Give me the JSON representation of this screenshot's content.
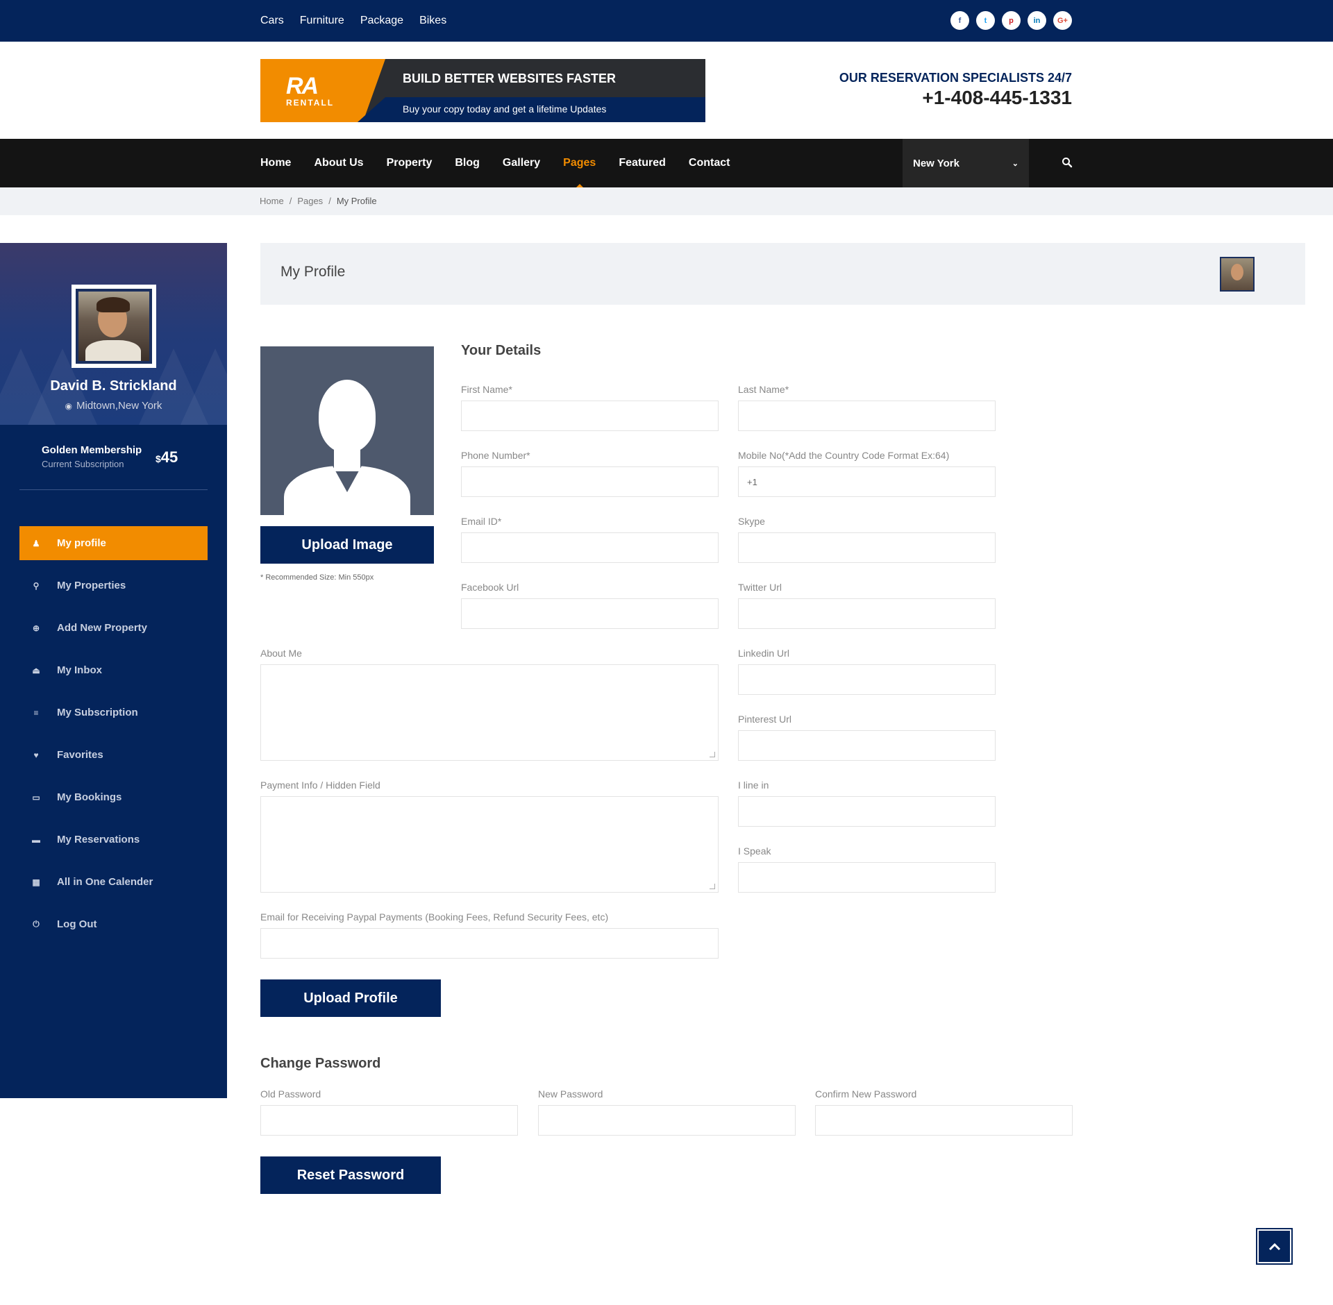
{
  "topbar": {
    "links": [
      "Cars",
      "Furniture",
      "Package",
      "Bikes"
    ],
    "socials": [
      {
        "icon": "facebook-icon",
        "glyph": "f",
        "color": "#3b5998"
      },
      {
        "icon": "twitter-icon",
        "glyph": "t",
        "color": "#1da1f2"
      },
      {
        "icon": "pinterest-icon",
        "glyph": "p",
        "color": "#cb2027"
      },
      {
        "icon": "linkedin-icon",
        "glyph": "in",
        "color": "#0077b5"
      },
      {
        "icon": "google-plus-icon",
        "glyph": "G+",
        "color": "#dd4b39"
      }
    ]
  },
  "header": {
    "banner_logo_mark": "RA",
    "banner_logo_name": "RENTALL",
    "banner_title": "BUILD BETTER WEBSITES FASTER",
    "banner_subtitle": "Buy your copy today and get a lifetime Updates",
    "reservation_label": "OUR RESERVATION SPECIALISTS 24/7",
    "reservation_phone": "+1-408-445-1331"
  },
  "nav": {
    "items": [
      "Home",
      "About Us",
      "Property",
      "Blog",
      "Gallery",
      "Pages",
      "Featured",
      "Contact"
    ],
    "active": "Pages",
    "city": "New York",
    "city_icon": "chevron-down-icon",
    "search_icon": "search-icon"
  },
  "breadcrumb": {
    "items": [
      "Home",
      "Pages",
      "My Profile"
    ],
    "separator": "/"
  },
  "sidebar": {
    "name": "David B. Strickland",
    "location": "Midtown,New York",
    "membership": "Golden Membership",
    "membership_sub": "Current Subscription",
    "price_currency": "$",
    "price_amount": "45",
    "menu": [
      {
        "label": "My profile",
        "icon": "user-icon",
        "glyph": "♟",
        "active": true
      },
      {
        "label": "My Properties",
        "icon": "map-marker-icon",
        "glyph": "⚲",
        "active": false
      },
      {
        "label": "Add New Property",
        "icon": "plus-circle-icon",
        "glyph": "⊕",
        "active": false
      },
      {
        "label": "My Inbox",
        "icon": "inbox-icon",
        "glyph": "⏏",
        "active": false
      },
      {
        "label": "My Subscription",
        "icon": "list-icon",
        "glyph": "≡",
        "active": false
      },
      {
        "label": "Favorites",
        "icon": "heart-icon",
        "glyph": "♥",
        "active": false
      },
      {
        "label": "My Bookings",
        "icon": "folder-open-icon",
        "glyph": "▭",
        "active": false
      },
      {
        "label": "My Reservations",
        "icon": "folder-icon",
        "glyph": "▬",
        "active": false
      },
      {
        "label": "All in One Calender",
        "icon": "calendar-icon",
        "glyph": "▦",
        "active": false
      },
      {
        "label": "Log Out",
        "icon": "power-icon",
        "glyph": "⏻",
        "active": false
      }
    ]
  },
  "main": {
    "title": "My Profile",
    "upload_image": "Upload Image",
    "recommended": "* Recommended Size: Min 550px",
    "details_title": "Your Details",
    "fields": {
      "first_name": {
        "label": "First Name*",
        "value": ""
      },
      "last_name": {
        "label": "Last Name*",
        "value": ""
      },
      "phone": {
        "label": "Phone Number*",
        "value": ""
      },
      "mobile": {
        "label": "Mobile No(*Add the Country Code Format Ex:64)",
        "value": "+1"
      },
      "email": {
        "label": "Email ID*",
        "value": ""
      },
      "skype": {
        "label": "Skype",
        "value": ""
      },
      "facebook": {
        "label": "Facebook Url",
        "value": ""
      },
      "twitter": {
        "label": "Twitter Url",
        "value": ""
      },
      "about": {
        "label": "About Me",
        "value": ""
      },
      "linkedin": {
        "label": "Linkedin Url",
        "value": ""
      },
      "pinterest": {
        "label": "Pinterest Url",
        "value": ""
      },
      "payment": {
        "label": "Payment Info / Hidden Field",
        "value": ""
      },
      "live_in": {
        "label": "I line in",
        "value": ""
      },
      "speak": {
        "label": "I Speak",
        "value": ""
      },
      "paypal": {
        "label": "Email for Receiving Paypal Payments (Booking Fees, Refund Security Fees, etc)",
        "value": ""
      }
    },
    "upload_profile": "Upload Profile",
    "password_title": "Change Password",
    "old_password": "Old Password",
    "new_password": "New Password",
    "confirm_password": "Confirm New Password",
    "reset_password": "Reset Password"
  },
  "back_to_top_icon": "chevron-up-icon",
  "colors": {
    "navy": "#04245b",
    "accent": "#f28c00",
    "nav_bg": "#141414"
  }
}
